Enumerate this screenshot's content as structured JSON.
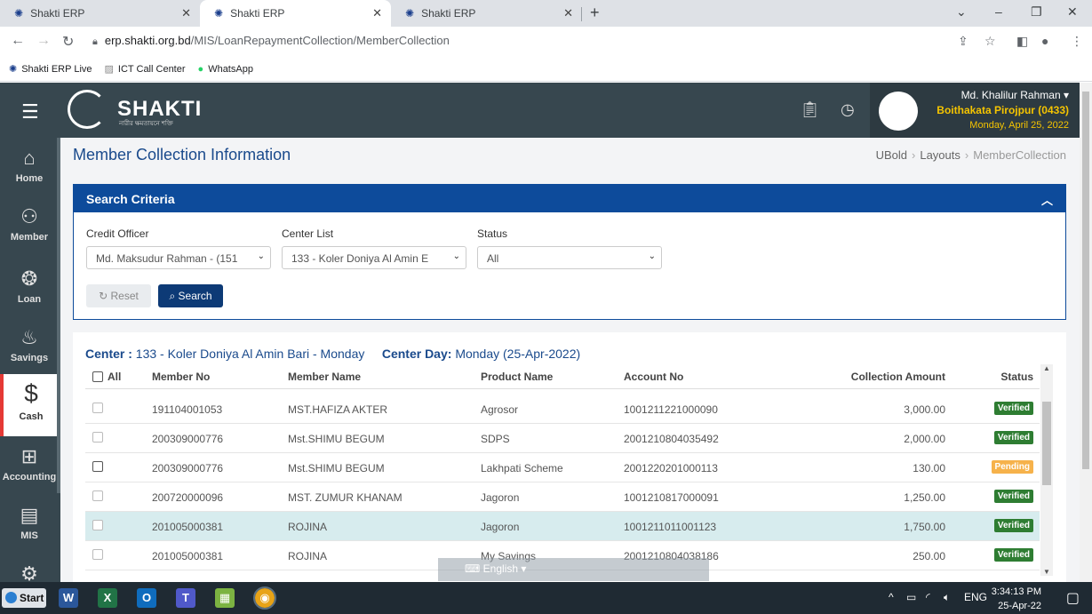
{
  "browser": {
    "tabs": [
      {
        "title": "Shakti ERP",
        "active": false
      },
      {
        "title": "Shakti ERP",
        "active": true
      },
      {
        "title": "Shakti ERP",
        "active": false
      }
    ],
    "url_host": "erp.shakti.org.bd",
    "url_path": "/MIS/LoanRepaymentCollection/MemberCollection",
    "bookmarks": [
      "Shakti ERP Live",
      "ICT Call Center",
      "WhatsApp"
    ]
  },
  "header": {
    "logo_text": "SHAKTI",
    "logo_sub": "নারীর ক্ষমতায়নে শক্তি",
    "user_name": "Md. Khalilur Rahman",
    "branch": "Boithakata Pirojpur (0433)",
    "date": "Monday, April 25, 2022"
  },
  "sidebar": {
    "items": [
      {
        "label": "Home",
        "icon": "home-icon"
      },
      {
        "label": "Member",
        "icon": "user-icon"
      },
      {
        "label": "Loan",
        "icon": "loan-icon"
      },
      {
        "label": "Savings",
        "icon": "savings-icon"
      },
      {
        "label": "Cash",
        "icon": "dollar-icon"
      },
      {
        "label": "Accounting",
        "icon": "calculator-icon"
      },
      {
        "label": "MIS",
        "icon": "report-icon"
      }
    ]
  },
  "page": {
    "title": "Member Collection Information",
    "breadcrumb": [
      "UBold",
      "Layouts",
      "MemberCollection"
    ]
  },
  "search": {
    "title": "Search Criteria",
    "credit_officer_label": "Credit Officer",
    "credit_officer_value": "Md. Maksudur Rahman - (151",
    "center_list_label": "Center List",
    "center_list_value": "133 - Koler Doniya Al Amin E",
    "status_label": "Status",
    "status_value": "All",
    "reset_label": "Reset",
    "search_label": "Search"
  },
  "table": {
    "center_label": "Center :",
    "center_value": "133 - Koler Doniya Al Amin Bari - Monday",
    "center_day_label": "Center Day:",
    "center_day_value": "Monday (25-Apr-2022)",
    "headers": {
      "all": "All",
      "member_no": "Member No",
      "member_name": "Member Name",
      "product_name": "Product Name",
      "account_no": "Account No",
      "collection_amount": "Collection Amount",
      "status": "Status"
    },
    "rows": [
      {
        "member_no": "191104001053",
        "member_name": "MST.HAFIZA AKTER",
        "product": "Agrosor",
        "account_no": "1001211221000090",
        "amount": "3,000.00",
        "status": "Verified"
      },
      {
        "member_no": "200309000776",
        "member_name": "Mst.SHIMU BEGUM",
        "product": "SDPS",
        "account_no": "2001210804035492",
        "amount": "2,000.00",
        "status": "Verified"
      },
      {
        "member_no": "200309000776",
        "member_name": "Mst.SHIMU BEGUM",
        "product": "Lakhpati Scheme",
        "account_no": "2001220201000113",
        "amount": "130.00",
        "status": "Pending"
      },
      {
        "member_no": "200720000096",
        "member_name": "MST. ZUMUR KHANAM",
        "product": "Jagoron",
        "account_no": "1001210817000091",
        "amount": "1,250.00",
        "status": "Verified"
      },
      {
        "member_no": "201005000381",
        "member_name": "ROJINA",
        "product": "Jagoron",
        "account_no": "1001211011001123",
        "amount": "1,750.00",
        "status": "Verified"
      },
      {
        "member_no": "201005000381",
        "member_name": "ROJINA",
        "product": "My Savings",
        "account_no": "2001210804038186",
        "amount": "250.00",
        "status": "Verified"
      }
    ]
  },
  "langbar": {
    "text": "English"
  },
  "taskbar": {
    "start_label": "Start",
    "lang": "ENG",
    "time": "3:34:13 PM",
    "date": "25-Apr-22"
  }
}
